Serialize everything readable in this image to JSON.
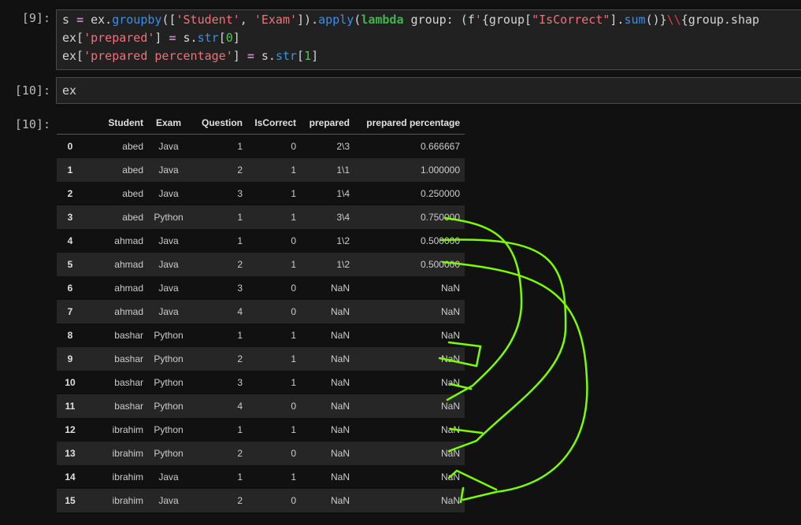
{
  "cells": [
    {
      "prompt": "[9]:",
      "lines": [
        [
          [
            "s ",
            ""
          ],
          [
            "=",
            "kw"
          ],
          [
            " ex.",
            ""
          ],
          [
            "groupby",
            "fn"
          ],
          [
            "([",
            ""
          ],
          [
            "'Student'",
            "st"
          ],
          [
            ", ",
            ""
          ],
          [
            "'Exam'",
            "st"
          ],
          [
            "]).",
            ""
          ],
          [
            "apply",
            "fn"
          ],
          [
            "(",
            ""
          ],
          [
            "lambda",
            "lm"
          ],
          [
            " group: (f",
            ""
          ],
          [
            "'",
            "st"
          ],
          [
            "{group[",
            ""
          ],
          [
            "\"IsCorrect\"",
            "st"
          ],
          [
            "].",
            ""
          ],
          [
            "sum",
            "fn"
          ],
          [
            "()}",
            ""
          ],
          [
            "\\\\",
            "es"
          ],
          [
            "{group.shap",
            ""
          ]
        ],
        [
          [
            "ex[",
            ""
          ],
          [
            "'prepared'",
            "st"
          ],
          [
            "] ",
            ""
          ],
          [
            "=",
            "kw"
          ],
          [
            " s.",
            ""
          ],
          [
            "str",
            "fn"
          ],
          [
            "[",
            ""
          ],
          [
            "0",
            "nm"
          ],
          [
            "]",
            ""
          ]
        ],
        [
          [
            "ex[",
            ""
          ],
          [
            "'prepared percentage'",
            "st"
          ],
          [
            "] ",
            ""
          ],
          [
            "=",
            "kw"
          ],
          [
            " s.",
            ""
          ],
          [
            "str",
            "fn"
          ],
          [
            "[",
            ""
          ],
          [
            "1",
            "nm"
          ],
          [
            "]",
            ""
          ]
        ]
      ]
    },
    {
      "prompt": "[10]:",
      "lines": [
        [
          [
            "ex",
            ""
          ]
        ]
      ]
    }
  ],
  "output": {
    "prompt": "[10]:",
    "columns": [
      "",
      "Student",
      "Exam",
      "Question",
      "IsCorrect",
      "prepared",
      "prepared percentage"
    ],
    "rows": [
      [
        "0",
        "abed",
        "Java",
        "1",
        "0",
        "2\\3",
        "0.666667"
      ],
      [
        "1",
        "abed",
        "Java",
        "2",
        "1",
        "1\\1",
        "1.000000"
      ],
      [
        "2",
        "abed",
        "Java",
        "3",
        "1",
        "1\\4",
        "0.250000"
      ],
      [
        "3",
        "abed",
        "Python",
        "1",
        "1",
        "3\\4",
        "0.750000"
      ],
      [
        "4",
        "ahmad",
        "Java",
        "1",
        "0",
        "1\\2",
        "0.500000"
      ],
      [
        "5",
        "ahmad",
        "Java",
        "2",
        "1",
        "1\\2",
        "0.500000"
      ],
      [
        "6",
        "ahmad",
        "Java",
        "3",
        "0",
        "NaN",
        "NaN"
      ],
      [
        "7",
        "ahmad",
        "Java",
        "4",
        "0",
        "NaN",
        "NaN"
      ],
      [
        "8",
        "bashar",
        "Python",
        "1",
        "1",
        "NaN",
        "NaN"
      ],
      [
        "9",
        "bashar",
        "Python",
        "2",
        "1",
        "NaN",
        "NaN"
      ],
      [
        "10",
        "bashar",
        "Python",
        "3",
        "1",
        "NaN",
        "NaN"
      ],
      [
        "11",
        "bashar",
        "Python",
        "4",
        "0",
        "NaN",
        "NaN"
      ],
      [
        "12",
        "ibrahim",
        "Python",
        "1",
        "1",
        "NaN",
        "NaN"
      ],
      [
        "13",
        "ibrahim",
        "Python",
        "2",
        "0",
        "NaN",
        "NaN"
      ],
      [
        "14",
        "ibrahim",
        "Java",
        "1",
        "1",
        "NaN",
        "NaN"
      ],
      [
        "15",
        "ibrahim",
        "Java",
        "2",
        "0",
        "NaN",
        "NaN"
      ]
    ]
  },
  "annotation_color": "#7cfc00"
}
